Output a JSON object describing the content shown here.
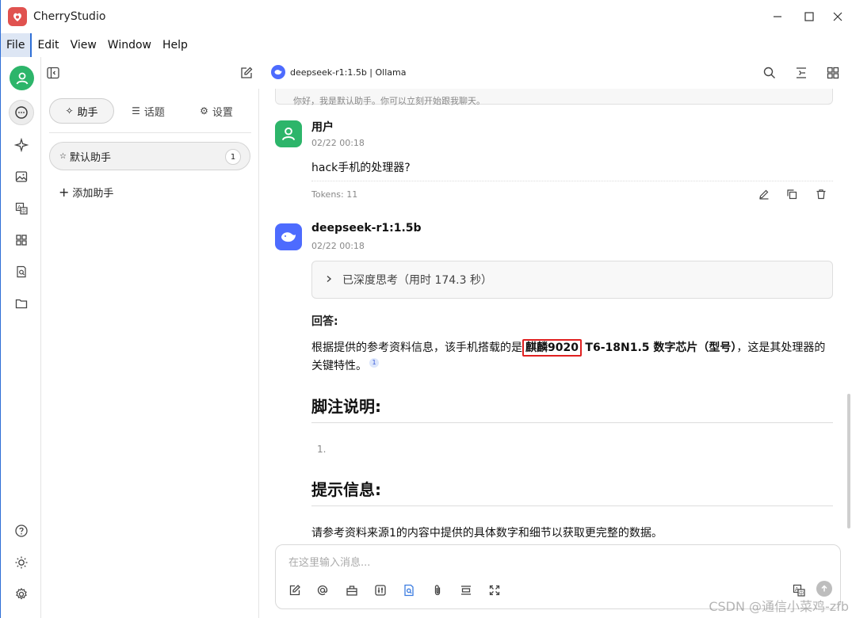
{
  "window": {
    "title": "CherryStudio"
  },
  "menu": [
    "File",
    "Edit",
    "View",
    "Window",
    "Help"
  ],
  "topbar": {
    "model_label": "deepseek-r1:1.5b | Ollama"
  },
  "panel": {
    "tabs": [
      {
        "icon": "✧",
        "label": "助手"
      },
      {
        "icon": "☰",
        "label": "话题"
      },
      {
        "icon": "⚙",
        "label": "设置"
      }
    ],
    "assistant": {
      "icon": "☆",
      "label": "默认助手",
      "count": "1"
    },
    "add_label": "添加助手"
  },
  "chat": {
    "prev_text": "你好，我是默认助手。你可以立刻开始跟我聊天。",
    "user": {
      "name": "用户",
      "time": "02/22 00:18",
      "text": "hack手机的处理器?",
      "tokens": "Tokens: 11"
    },
    "bot": {
      "name": "deepseek-r1:1.5b",
      "time": "02/22 00:18",
      "thinking": "已深度思考（用时 174.3 秒）",
      "answer_label": "回答:",
      "para_before": "根据提供的参考资料信息，该手机搭载的是",
      "para_highlight": "麒麟9020",
      "para_bold": "T6-18N1.5 数字芯片（型号）",
      "para_after": "，这是其处理器的关键特性。",
      "citation": "1",
      "footnote_heading": "脚注说明:",
      "list_marker": "1.",
      "tips_heading": "提示信息:",
      "tips_text": "请参考资料来源1的内容中提供的具体数字和细节以获取更完整的数据。"
    }
  },
  "input": {
    "placeholder": "在这里输入消息..."
  },
  "watermark": "CSDN @通信小菜鸡-zfb",
  "colors": {
    "accent_green": "#2db56a",
    "deepseek_blue": "#4d6bfe",
    "highlight_red": "#e02020",
    "logo_red": "#e0524f"
  }
}
